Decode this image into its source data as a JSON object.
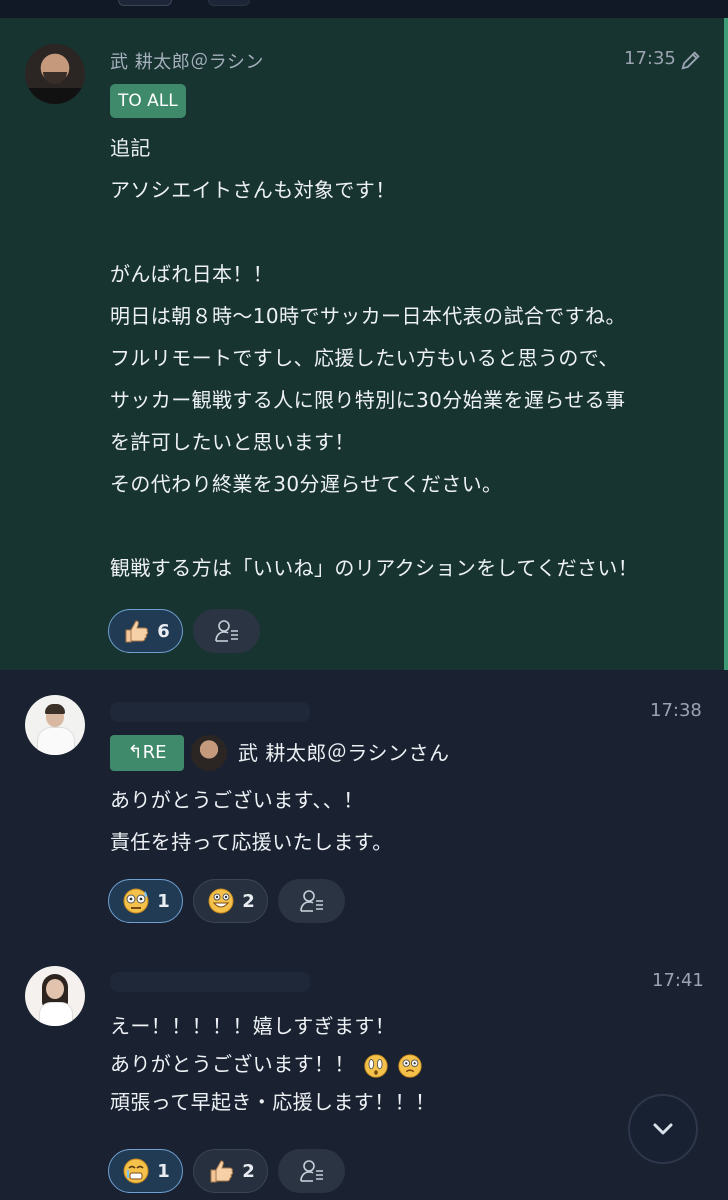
{
  "messages": [
    {
      "author": "武 耕太郎＠ラシン",
      "time": "17:35",
      "tag": "TO ALL",
      "lines": [
        "追記",
        "アソシエイトさんも対象です！",
        "",
        "がんばれ日本！！",
        "明日は朝８時〜10時でサッカー日本代表の試合ですね。",
        "フルリモートですし、応援したい方もいると思うので、",
        "サッカー観戦する人に限り特別に30分始業を遅らせる事",
        "を許可したいと思います！",
        "その代わり終業を30分遅らせてください。",
        "",
        "観戦する方は「いいね」のリアクションをしてください！"
      ],
      "reactions": [
        {
          "emoji": "thumbs-up-icon",
          "count": "6",
          "active": true
        }
      ]
    },
    {
      "author": "",
      "time": "17:38",
      "reply_label": "RE",
      "reply_to": "武 耕太郎＠ラシンさん",
      "lines": [
        "ありがとうございます、、！",
        "責任を持って応援いたします。"
      ],
      "reactions": [
        {
          "emoji": "sweat-face-icon",
          "count": "1",
          "active": true
        },
        {
          "emoji": "grin-face-icon",
          "count": "2",
          "active": false
        }
      ]
    },
    {
      "author": "",
      "time": "17:41",
      "lines": [
        "えー！！！！！嬉しすぎます！",
        "ありがとうございます！！",
        "頑張って早起き・応援します！！！"
      ],
      "reactions": [
        {
          "emoji": "crying-face-icon",
          "count": "1",
          "active": true
        },
        {
          "emoji": "thumbs-up-icon",
          "count": "2",
          "active": false
        }
      ]
    }
  ],
  "colors": {
    "background": "#1a2232",
    "highlight": "#173431",
    "accent": "#3f8a6b",
    "active_reaction_border": "#6fa0cf"
  }
}
